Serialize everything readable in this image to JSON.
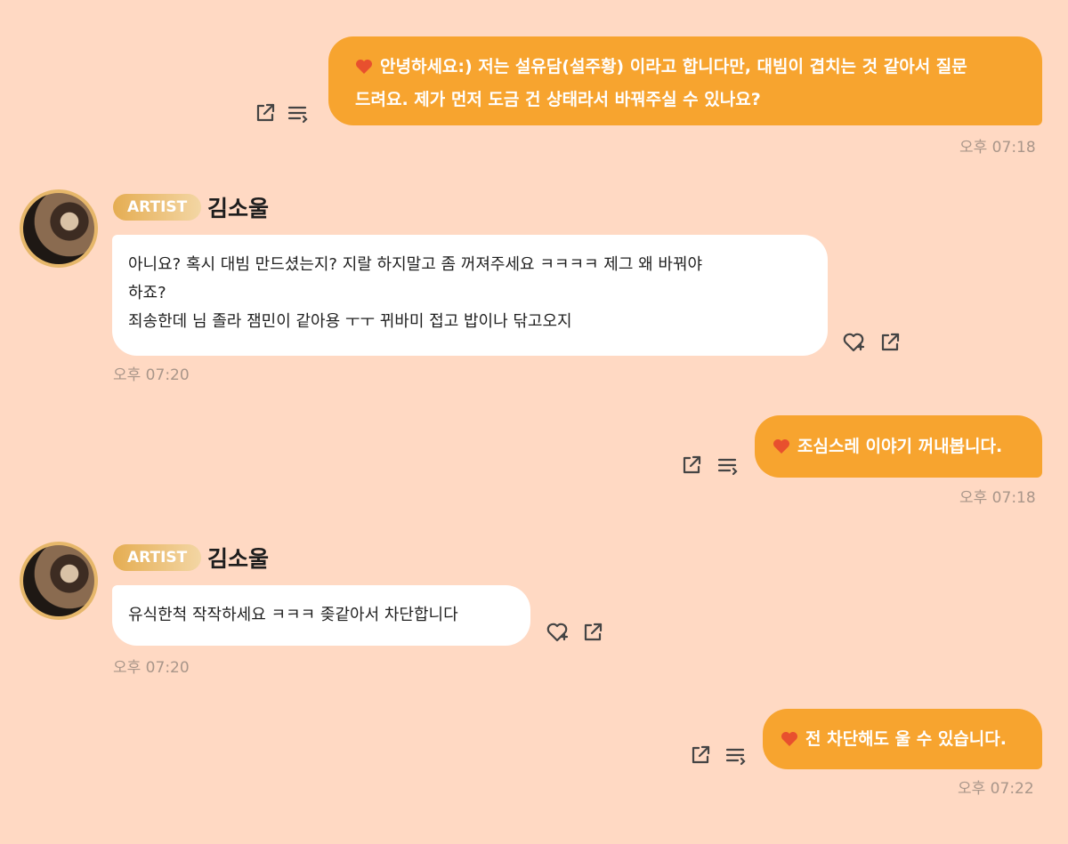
{
  "messages": [
    {
      "sender": "me",
      "text_line1": "안녕하세요:) 저는 설유담(설주황) 이라고 합니다만, 대빔이 겹치는 것 같아서 질문",
      "text_line2": "드려요. 제가 먼저 도금 건 상태라서 바꿔주실 수 있나요?",
      "time": "오후 07:18"
    },
    {
      "sender": "artist",
      "badge": "ARTIST",
      "name": "김소울",
      "text_line1": "아니요? 혹시 대빔 만드셨는지? 지랄 하지말고 좀 꺼져주세요 ㅋㅋㅋㅋ 제그 왜 바꿔야",
      "text_line2": "하죠?",
      "text_line3": "죄송한데 님 졸라 잼민이 같아용 ㅜㅜ 뀌바미 접고 밥이나 닦고오지",
      "time": "오후 07:20"
    },
    {
      "sender": "me",
      "text_line1": "조심스레 이야기 꺼내봅니다.",
      "time": "오후 07:18"
    },
    {
      "sender": "artist",
      "badge": "ARTIST",
      "name": "김소울",
      "text_line1": "유식한척 작작하세요 ㅋㅋㅋ 좆같아서 차단합니다",
      "time": "오후 07:20"
    },
    {
      "sender": "me",
      "text_line1": "전 차단해도 울 수 있습니다.",
      "time": "오후 07:22"
    }
  ],
  "icons": {
    "share": "share-icon",
    "menu": "menu-icon",
    "heart_reaction": "heart-reaction-icon",
    "bubble_heart": "heart-icon"
  },
  "colors": {
    "background": "#ffd9c3",
    "outgoing_bubble": "#f7a42f",
    "incoming_bubble": "#ffffff",
    "badge": "#e5ad52",
    "timestamp": "#a9968a"
  }
}
